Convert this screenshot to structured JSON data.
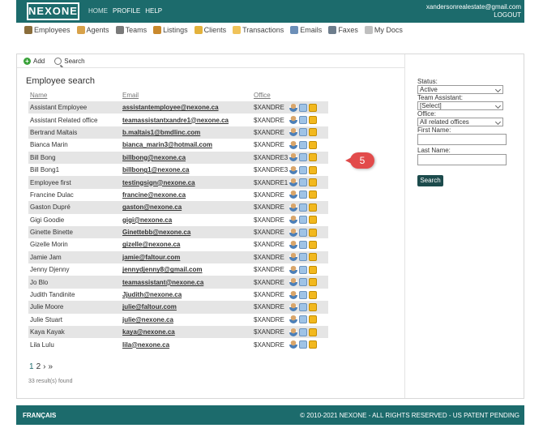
{
  "header": {
    "logo": "NEXONE",
    "nav": [
      "HOME",
      "PROFILE",
      "HELP"
    ],
    "user_email": "xandersonrealestate@gmail.com",
    "logout": "LOGOUT"
  },
  "main_nav": [
    {
      "label": "Employees",
      "icon": "employees-icon",
      "color": "#8a6d3b"
    },
    {
      "label": "Agents",
      "icon": "agents-icon",
      "color": "#d8a24a"
    },
    {
      "label": "Teams",
      "icon": "teams-icon",
      "color": "#7a7a7a"
    },
    {
      "label": "Listings",
      "icon": "listings-icon",
      "color": "#c9892d"
    },
    {
      "label": "Clients",
      "icon": "clients-icon",
      "color": "#e3b23c"
    },
    {
      "label": "Transactions",
      "icon": "folder-icon",
      "color": "#f0c35a"
    },
    {
      "label": "Emails",
      "icon": "email-icon",
      "color": "#6c8fb8"
    },
    {
      "label": "Faxes",
      "icon": "fax-icon",
      "color": "#6d7d8c"
    },
    {
      "label": "My Docs",
      "icon": "docs-icon",
      "color": "#bfbfbf"
    }
  ],
  "toolbar": {
    "add": "Add",
    "search": "Search"
  },
  "page_title": "Employee search",
  "columns": {
    "name": "Name",
    "email": "Email",
    "office": "Office"
  },
  "employees": [
    {
      "name": "Assistant Employee",
      "email": "assistantemployee@nexone.ca",
      "office": "$XANDRE"
    },
    {
      "name": "Assistant Related office",
      "email": "teamassistantxandre1@nexone.ca",
      "office": "$XANDRE"
    },
    {
      "name": "Bertrand Maltais",
      "email": "b.maltais1@bmdlinc.com",
      "office": "$XANDRE"
    },
    {
      "name": "Bianca Marin",
      "email": "bianca_marin3@hotmail.com",
      "office": "$XANDRE"
    },
    {
      "name": "Bill Bong",
      "email": "billbong@nexone.ca",
      "office": "$XANDRE3"
    },
    {
      "name": "Bill Bong1",
      "email": "billbong1@nexone.ca",
      "office": "$XANDRE3"
    },
    {
      "name": "Employee first",
      "email": "testingsign@nexone.ca",
      "office": "$XANDRE1"
    },
    {
      "name": "Francine Dulac",
      "email": "francine@nexone.ca",
      "office": "$XANDRE"
    },
    {
      "name": "Gaston Dupré",
      "email": "gaston@nexone.ca",
      "office": "$XANDRE"
    },
    {
      "name": "Gigi Goodie",
      "email": "gigi@nexone.ca",
      "office": "$XANDRE"
    },
    {
      "name": "Ginette Binette",
      "email": "Ginettebb@nexone.ca",
      "office": "$XANDRE"
    },
    {
      "name": "Gizelle Morin",
      "email": "gizelle@nexone.ca",
      "office": "$XANDRE"
    },
    {
      "name": "Jamie Jam",
      "email": "jamie@faltour.com",
      "office": "$XANDRE"
    },
    {
      "name": "Jenny Djenny",
      "email": "jennydjenny8@gmail.com",
      "office": "$XANDRE"
    },
    {
      "name": "Jo Blo",
      "email": "teamassistant@nexone.ca",
      "office": "$XANDRE"
    },
    {
      "name": "Judith Tandinite",
      "email": "Jjudith@nexone.ca",
      "office": "$XANDRE"
    },
    {
      "name": "Julie Moore",
      "email": "julie@faltour.com",
      "office": "$XANDRE"
    },
    {
      "name": "Julie Stuart",
      "email": "julie@nexone.ca",
      "office": "$XANDRE"
    },
    {
      "name": "Kaya Kayak",
      "email": "kaya@nexone.ca",
      "office": "$XANDRE"
    },
    {
      "name": "Lila Lulu",
      "email": "lila@nexone.ca",
      "office": "$XANDRE"
    }
  ],
  "pager": {
    "page1": "1",
    "page2": "2",
    "next": "›",
    "last": "»"
  },
  "results": "33 result(s) found",
  "callout": "5",
  "filters": {
    "status_label": "Status:",
    "status_value": "Active",
    "team_assistant_label": "Team Assistant:",
    "team_assistant_value": "[Select]",
    "office_label": "Office:",
    "office_value": "All related offices",
    "first_name_label": "First Name:",
    "last_name_label": "Last Name:",
    "search_button": "Search"
  },
  "footer": {
    "language": "FRANÇAIS",
    "copyright": "© 2010-2021 NEXONE - ALL RIGHTS RESERVED - US PATENT PENDING"
  },
  "colors": {
    "brand": "#1c6b6c",
    "callout": "#e24b4b"
  }
}
